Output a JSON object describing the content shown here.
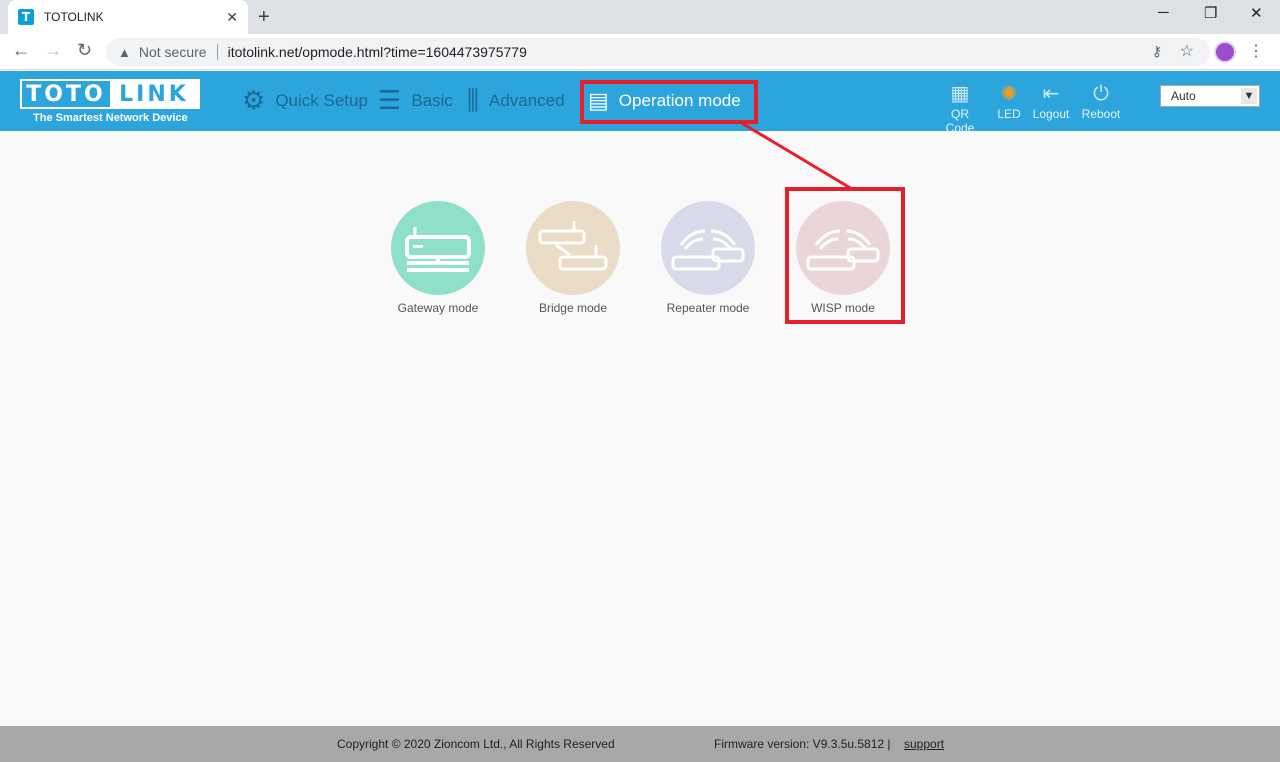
{
  "browser": {
    "tab_title": "TOTOLINK",
    "favicon_letter": "T",
    "security_label": "Not secure",
    "url": "itotolink.net/opmode.html?time=1604473975779"
  },
  "header": {
    "logo_left": "TOTO",
    "logo_right": "LINK",
    "tagline": "The Smartest Network Device",
    "nav": {
      "quick_setup": "Quick Setup",
      "basic": "Basic",
      "advanced": "Advanced",
      "operation_mode": "Operation mode"
    },
    "tools": {
      "qr_code": "QR Code",
      "led": "LED",
      "logout": "Logout",
      "reboot": "Reboot"
    },
    "language": "Auto"
  },
  "modes": [
    {
      "label": "Gateway mode",
      "color": "#8fe0cb"
    },
    {
      "label": "Bridge mode",
      "color": "#eadcc6"
    },
    {
      "label": "Repeater mode",
      "color": "#dadbea"
    },
    {
      "label": "WISP mode",
      "color": "#ead6d8"
    }
  ],
  "highlight_color": "#e5202b",
  "footer": {
    "copyright": "Copyright © 2020 Zioncom Ltd., All Rights Reserved",
    "firmware": "Firmware version: V9.3.5u.5812  |",
    "support": "support"
  }
}
